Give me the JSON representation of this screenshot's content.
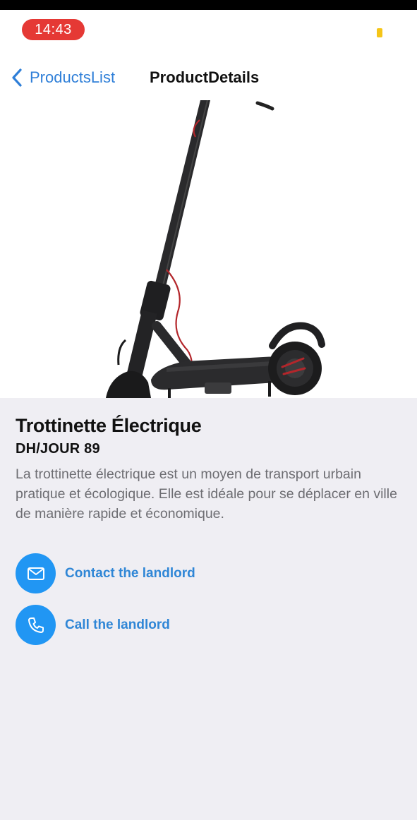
{
  "status_bar": {
    "time": "14:43",
    "time_pill_color": "#e53935",
    "battery_color": "#f5c518"
  },
  "nav": {
    "back_label": "ProductsList",
    "title": "ProductDetails",
    "accent_color": "#2f7fd8"
  },
  "hero": {
    "image_icon": "electric-scooter-illustration",
    "float_button_icon": "circle-button"
  },
  "product": {
    "title": "Trottinette Électrique",
    "price": "DH/JOUR 89",
    "description": "La trottinette électrique est un moyen de transport urbain pratique et écologique. Elle est idéale pour se déplacer en ville de manière rapide et économique."
  },
  "actions": [
    {
      "label": "Contact the landlord",
      "icon": "mail-icon"
    },
    {
      "label": "Call the landlord",
      "icon": "phone-icon"
    }
  ],
  "colors": {
    "action_circle": "#2196f3",
    "action_text": "#2f86d6",
    "background": "#efeef3"
  }
}
